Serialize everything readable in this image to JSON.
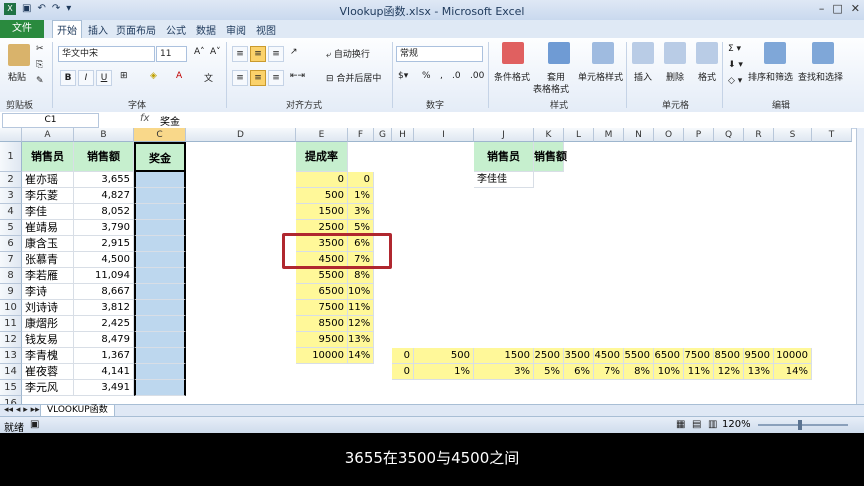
{
  "window": {
    "title": "Vlookup函数.xlsx - Microsoft Excel"
  },
  "tabs": {
    "file": "文件",
    "items": [
      "开始",
      "插入",
      "页面布局",
      "公式",
      "数据",
      "审阅",
      "视图"
    ]
  },
  "ribbon": {
    "paste": "粘贴",
    "clipboard": "剪贴板",
    "font_name": "华文中宋",
    "font_size": "11",
    "font_group": "字体",
    "wrap": "自动换行",
    "merge": "合并后居中",
    "align_group": "对齐方式",
    "number_format": "常规",
    "number_group": "数字",
    "cond_format": "条件格式",
    "table_format": "套用\n表格格式",
    "table_format_a": "套用",
    "table_format_b": "表格格式",
    "cell_style": "单元格样式",
    "style_group": "样式",
    "insert": "插入",
    "delete": "删除",
    "format": "格式",
    "cells_group": "单元格",
    "sort": "排序和筛选",
    "find": "查找和选择",
    "edit_group": "编辑",
    "bold": "B",
    "italic": "I",
    "underline": "U",
    "percent": "%",
    "comma": ","
  },
  "formula_bar": {
    "name_box": "C1",
    "fx": "fx",
    "content": "奖金"
  },
  "columns": [
    "A",
    "B",
    "C",
    "D",
    "E",
    "F",
    "G",
    "H",
    "I",
    "J",
    "K",
    "L",
    "M",
    "N",
    "O",
    "P",
    "Q",
    "R",
    "S",
    "T"
  ],
  "rows": [
    "1",
    "2",
    "3",
    "4",
    "5",
    "6",
    "7",
    "8",
    "9",
    "10",
    "11",
    "12",
    "13",
    "14",
    "15",
    "16"
  ],
  "headers": {
    "a1": "销售员",
    "b1": "销售额",
    "c1": "奖金",
    "e1": "提成率",
    "j1": "销售员",
    "k1": "销售额"
  },
  "j2": "李佳佳",
  "sales": [
    {
      "name": "崔亦瑶",
      "amount": "3,655"
    },
    {
      "name": "李乐菱",
      "amount": "4,827"
    },
    {
      "name": "李佳",
      "amount": "8,052"
    },
    {
      "name": "崔靖易",
      "amount": "3,790"
    },
    {
      "name": "康含玉",
      "amount": "2,915"
    },
    {
      "name": "张慕青",
      "amount": "4,500"
    },
    {
      "name": "李若雁",
      "amount": "11,094"
    },
    {
      "name": "李诗",
      "amount": "8,667"
    },
    {
      "name": "刘诗诗",
      "amount": "3,812"
    },
    {
      "name": "康熠彤",
      "amount": "2,425"
    },
    {
      "name": "钱友易",
      "amount": "8,479"
    },
    {
      "name": "李青槐",
      "amount": "1,367"
    },
    {
      "name": "崔夜蓉",
      "amount": "4,141"
    },
    {
      "name": "李元风",
      "amount": "3,491"
    }
  ],
  "rates": [
    {
      "threshold": "0",
      "rate": "0"
    },
    {
      "threshold": "500",
      "rate": "1%"
    },
    {
      "threshold": "1500",
      "rate": "3%"
    },
    {
      "threshold": "2500",
      "rate": "5%"
    },
    {
      "threshold": "3500",
      "rate": "6%"
    },
    {
      "threshold": "4500",
      "rate": "7%"
    },
    {
      "threshold": "5500",
      "rate": "8%"
    },
    {
      "threshold": "6500",
      "rate": "10%"
    },
    {
      "threshold": "7500",
      "rate": "11%"
    },
    {
      "threshold": "8500",
      "rate": "12%"
    },
    {
      "threshold": "9500",
      "rate": "13%"
    },
    {
      "threshold": "10000",
      "rate": "14%"
    }
  ],
  "h_thresholds": [
    "0",
    "500",
    "1500",
    "2500",
    "3500",
    "4500",
    "5500",
    "6500",
    "7500",
    "8500",
    "9500",
    "10000"
  ],
  "h_rates": [
    "0",
    "1%",
    "3%",
    "5%",
    "6%",
    "7%",
    "8%",
    "10%",
    "11%",
    "12%",
    "13%",
    "14%"
  ],
  "sheet": {
    "name": "VLOOKUP函数"
  },
  "status": {
    "ready": "就绪",
    "zoom": "120%"
  },
  "subtitle": "3655在3500与4500之间",
  "colors": {
    "highlight_yellow": "#fff899",
    "header_green": "#c6efce",
    "selected_blue": "#bdd7ee",
    "annotation_red": "#b0272f"
  }
}
